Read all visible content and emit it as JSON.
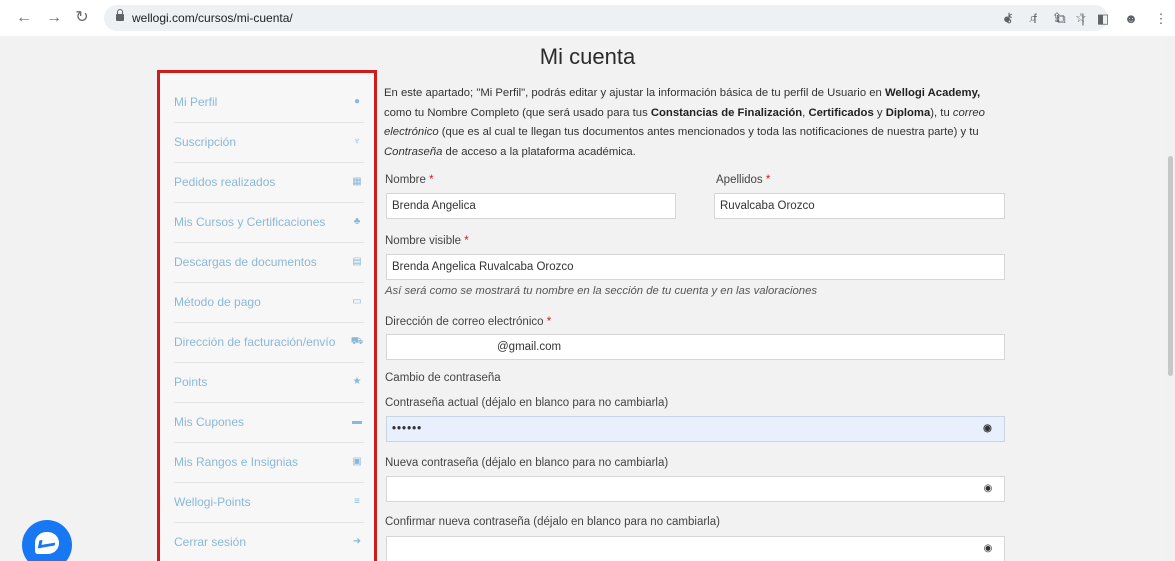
{
  "browser": {
    "url": "wellogi.com/cursos/mi-cuenta/"
  },
  "page": {
    "title": "Mi cuenta"
  },
  "sidebar": {
    "items": [
      {
        "label": "Mi Perfil",
        "icon": "user-icon"
      },
      {
        "label": "Suscripción",
        "icon": "trophy-icon"
      },
      {
        "label": "Pedidos realizados",
        "icon": "building-icon"
      },
      {
        "label": "Mis Cursos y Certificaciones",
        "icon": "graduation-icon"
      },
      {
        "label": "Descargas de documentos",
        "icon": "file-download-icon"
      },
      {
        "label": "Método de pago",
        "icon": "credit-card-icon"
      },
      {
        "label": "Dirección de facturación/envío",
        "icon": "truck-icon"
      },
      {
        "label": "Points",
        "icon": "star-icon"
      },
      {
        "label": "Mis Cupones",
        "icon": "ticket-icon"
      },
      {
        "label": "Mis Rangos e Insignias",
        "icon": "badge-icon"
      },
      {
        "label": "Wellogi-Points",
        "icon": "coins-icon"
      },
      {
        "label": "Cerrar sesión",
        "icon": "logout-icon"
      }
    ]
  },
  "intro": {
    "p1": "En este apartado; \"Mi Perfil\", podrás editar y ajustar la información básica de tu perfil de Usuario en ",
    "b1": "Wellogi Academy,",
    "p2": " como tu Nombre Completo (que será usado para tus ",
    "b2": "Constancias de Finalización",
    "p3": ", ",
    "b3": "Certificados",
    "p4": " y ",
    "b4": "Diploma",
    "p5": "), tu ",
    "i1": "correo electrónico",
    "p6": " (que es al cual te llegan tus documentos antes mencionados y toda las notificaciones de nuestra parte) y tu ",
    "i2": "Contraseña",
    "p7": " de acceso a la plataforma académica."
  },
  "form": {
    "first_name_label": "Nombre",
    "first_name_value": "Brenda Angelica",
    "last_name_label": "Apellidos",
    "last_name_value": "Ruvalcaba Orozco",
    "display_name_label": "Nombre visible",
    "display_name_value": "Brenda Angelica Ruvalcaba Orozco",
    "display_name_hint": "Así será como se mostrará tu nombre en la sección de tu cuenta y en las valoraciones",
    "email_label": "Dirección de correo electrónico",
    "email_value": "@gmail.com",
    "password_section": "Cambio de contraseña",
    "current_password_label": "Contraseña actual (déjalo en blanco para no cambiarla)",
    "current_password_value": "••••••",
    "new_password_label": "Nueva contraseña (déjalo en blanco para no cambiarla)",
    "confirm_password_label": "Confirmar nueva contraseña (déjalo en blanco para no cambiarla)",
    "required_mark": "*"
  },
  "colors": {
    "sidebar_highlight": "#d11a1a",
    "sidebar_text": "#8ab8d8",
    "autofill": "#e8f0fe",
    "messenger": "#1877f2"
  }
}
